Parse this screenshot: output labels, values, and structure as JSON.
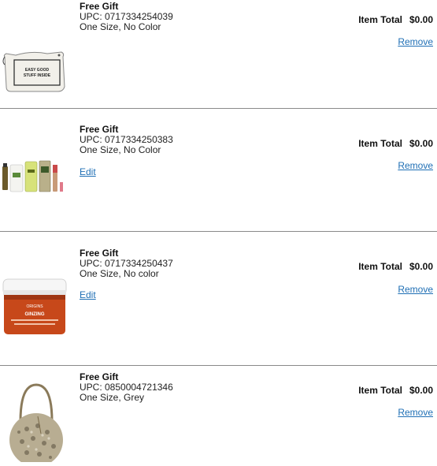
{
  "colors": {
    "link": "#1f6fb5",
    "divider": "#8a8a8a",
    "text": "#222222"
  },
  "items": [
    {
      "title": "Free Gift",
      "upc": "UPC: 0717334254039",
      "variant": "One Size, No Color",
      "total_label": "Item Total",
      "total_value": "$0.00",
      "remove_label": "Remove",
      "image_icon": "cosmetic-pouch-icon",
      "pouch_text_1": "EASY GOOD",
      "pouch_text_2": "STUFF INSIDE"
    },
    {
      "title": "Free Gift",
      "upc": "UPC: 0717334250383",
      "variant": "One Size, No Color",
      "edit_label": "Edit",
      "total_label": "Item Total",
      "total_value": "$0.00",
      "remove_label": "Remove",
      "image_icon": "skincare-set-icon"
    },
    {
      "title": "Free Gift",
      "upc": "UPC: 0717334250437",
      "variant": "One Size, No color",
      "edit_label": "Edit",
      "total_label": "Item Total",
      "total_value": "$0.00",
      "remove_label": "Remove",
      "image_icon": "cream-jar-icon",
      "jar_brand": "ORIGINS",
      "jar_product": "GINZING"
    },
    {
      "title": "Free Gift",
      "upc": "UPC: 0850004721346",
      "variant": "One Size, Grey",
      "total_label": "Item Total",
      "total_value": "$0.00",
      "remove_label": "Remove",
      "image_icon": "snakeskin-tote-icon"
    }
  ]
}
